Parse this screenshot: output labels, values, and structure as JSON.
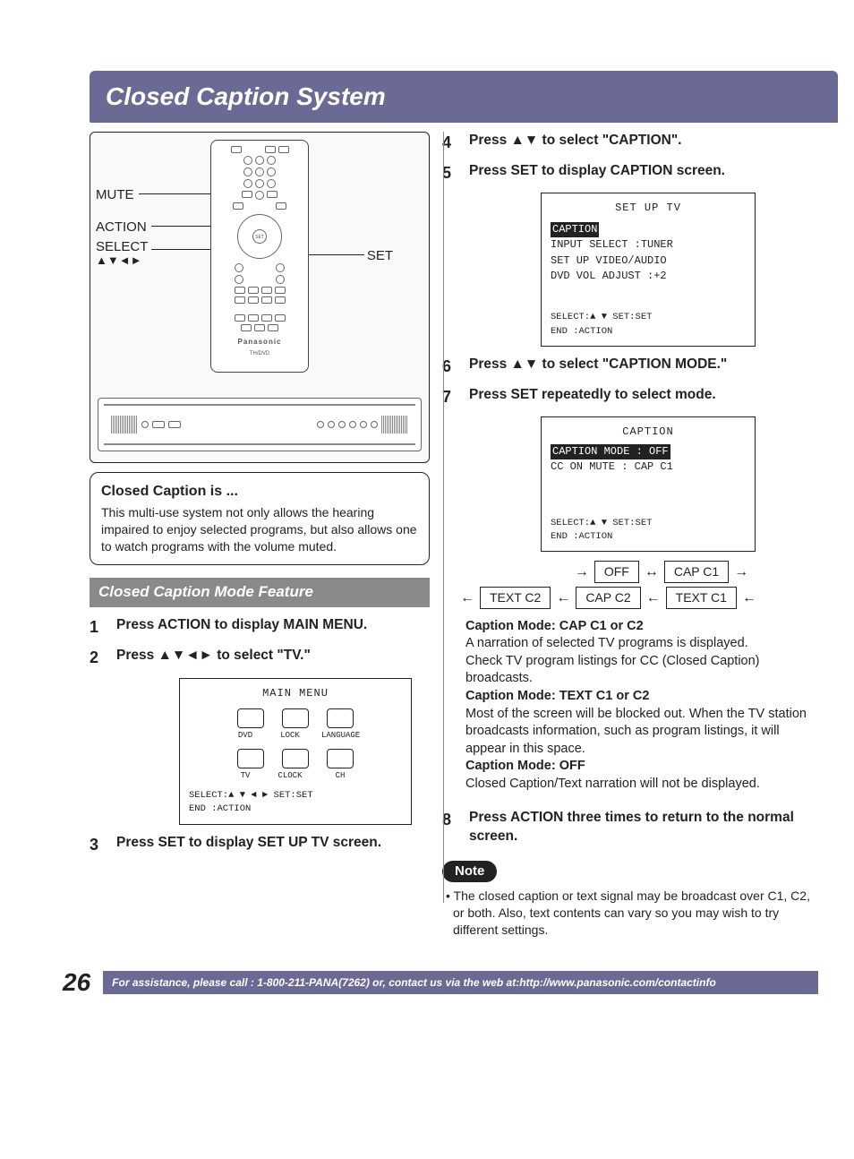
{
  "color_bars_left": [
    "#000",
    "#000",
    "#000",
    "#fff",
    "#000",
    "#fff",
    "#000"
  ],
  "color_bars_right": [
    "#d32aa5",
    "#fff",
    "#00a3a3",
    "#7a7a7a",
    "#fff57a",
    "#ff4fd0",
    "#7cc7ff",
    "#fff"
  ],
  "title": "Closed Caption System",
  "remote_callouts": {
    "mute": "MUTE",
    "action": "ACTION",
    "select": "SELECT",
    "arrows": "▲▼◄►",
    "set": "SET"
  },
  "remote_brand": "Panasonic",
  "remote_model": "TH/DVD",
  "info_box": {
    "title": "Closed Caption is ...",
    "body": "This multi-use system not only allows the hearing impaired to enjoy selected programs, but also allows one to watch programs with the volume muted."
  },
  "section_header": "Closed Caption Mode Feature",
  "steps_left": [
    {
      "num": "1",
      "text": "Press ACTION to display MAIN MENU."
    },
    {
      "num": "2",
      "text": "Press ▲▼◄► to select \"TV.\""
    },
    {
      "num": "3",
      "text": "Press SET to display SET UP TV screen."
    }
  ],
  "main_menu": {
    "title": "MAIN MENU",
    "row1": [
      "DVD",
      "LOCK",
      "LANGUAGE"
    ],
    "row2": [
      "TV",
      "CLOCK",
      "CH"
    ],
    "hint1": "SELECT:▲ ▼ ◄ ►   SET:SET",
    "hint2": "END   :ACTION"
  },
  "steps_right": [
    {
      "num": "4",
      "text": "Press ▲▼ to select \"CAPTION\"."
    },
    {
      "num": "5",
      "text": "Press SET to display CAPTION screen."
    },
    {
      "num": "6",
      "text": "Press ▲▼ to select \"CAPTION MODE.\""
    },
    {
      "num": "7",
      "text": "Press SET repeatedly to select mode."
    },
    {
      "num": "8",
      "text": "Press ACTION three times to return to the normal screen."
    }
  ],
  "setup_tv": {
    "title": "SET UP TV",
    "lines": [
      {
        "hl": "CAPTION",
        "rest": ""
      },
      {
        "hl": "",
        "rest": "INPUT SELECT   :TUNER"
      },
      {
        "hl": "",
        "rest": "SET UP VIDEO/AUDIO"
      },
      {
        "hl": "",
        "rest": "DVD VOL ADJUST :+2"
      }
    ],
    "hint1": "SELECT:▲ ▼       SET:SET",
    "hint2": "END   :ACTION"
  },
  "caption_menu": {
    "title": "CAPTION",
    "lines": [
      {
        "hl": "CAPTION MODE : OFF",
        "rest": ""
      },
      {
        "hl": "",
        "rest": "CC ON MUTE   : CAP C1"
      }
    ],
    "hint1": "SELECT:▲ ▼       SET:SET",
    "hint2": "END   :ACTION"
  },
  "flow": {
    "row1": [
      "OFF",
      "CAP C1"
    ],
    "row2": [
      "TEXT C2",
      "CAP C2",
      "TEXT C1"
    ]
  },
  "modes": {
    "cap_title": "Caption Mode: CAP C1 or C2",
    "cap_body1": "A narration of selected TV programs is displayed.",
    "cap_body2": "Check TV program listings for CC (Closed Caption) broadcasts.",
    "text_title": "Caption Mode: TEXT C1 or C2",
    "text_body": "Most of the screen will be blocked out. When the TV station broadcasts information, such as program listings, it will appear in this space.",
    "off_title": "Caption Mode: OFF",
    "off_body": "Closed Caption/Text narration will not be displayed."
  },
  "note_label": "Note",
  "note_body": "• The closed caption or text signal may be broadcast over C1, C2, or both. Also, text contents can vary so you may wish to try different settings.",
  "page_number": "26",
  "footer_text": "For assistance, please call : 1-800-211-PANA(7262) or, contact us via the web at:http://www.panasonic.com/contactinfo"
}
